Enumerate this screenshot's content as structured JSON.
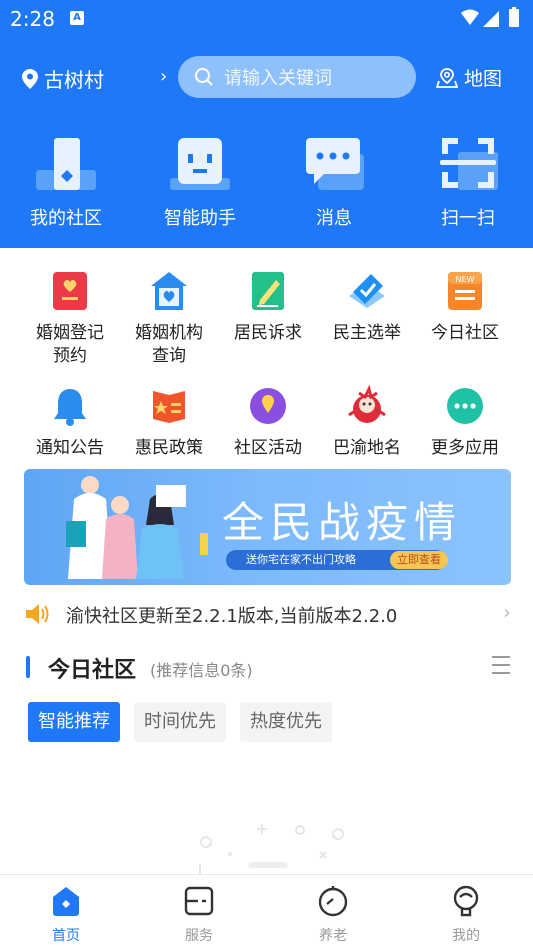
{
  "status_bar": {
    "time": "2:28",
    "a_icon": "A"
  },
  "header": {
    "location": "古树村",
    "search_placeholder": "请输入关键词",
    "map_label": "地图"
  },
  "quick_actions": [
    {
      "label": "我的社区",
      "icon": "community-icon"
    },
    {
      "label": "智能助手",
      "icon": "robot-icon"
    },
    {
      "label": "消息",
      "icon": "message-icon"
    },
    {
      "label": "扫一扫",
      "icon": "scan-icon"
    }
  ],
  "services_row1": [
    {
      "label_line1": "婚姻登记",
      "label_line2": "预约",
      "icon": "marriage-register-icon"
    },
    {
      "label_line1": "婚姻机构",
      "label_line2": "查询",
      "icon": "marriage-agency-icon"
    },
    {
      "label_line1": "居民诉求",
      "label_line2": "",
      "icon": "appeal-icon"
    },
    {
      "label_line1": "民主选举",
      "label_line2": "",
      "icon": "election-icon"
    },
    {
      "label_line1": "今日社区",
      "label_line2": "",
      "icon": "news-icon"
    }
  ],
  "services_row2": [
    {
      "label": "通知公告",
      "icon": "bell-icon"
    },
    {
      "label": "惠民政策",
      "icon": "policy-icon"
    },
    {
      "label": "社区活动",
      "icon": "activity-icon"
    },
    {
      "label": "巴渝地名",
      "icon": "mascot-icon"
    },
    {
      "label": "更多应用",
      "icon": "more-icon"
    }
  ],
  "banner": {
    "title": "全民战疫情",
    "subtitle": "送你宅在家不出门攻略",
    "button": "立即查看"
  },
  "notice": {
    "text": "渝快社区更新至2.2.1版本,当前版本2.2.0"
  },
  "today_section": {
    "title": "今日社区",
    "subtitle": "(推荐信息0条)",
    "tabs": [
      "智能推荐",
      "时间优先",
      "热度优先"
    ]
  },
  "tab_bar": [
    {
      "label": "首页",
      "icon": "home-icon"
    },
    {
      "label": "服务",
      "icon": "service-icon"
    },
    {
      "label": "养老",
      "icon": "elderly-icon"
    },
    {
      "label": "我的",
      "icon": "profile-icon"
    }
  ],
  "colors": {
    "primary": "#1f78f5",
    "search_bg": "#8ec0fb"
  }
}
